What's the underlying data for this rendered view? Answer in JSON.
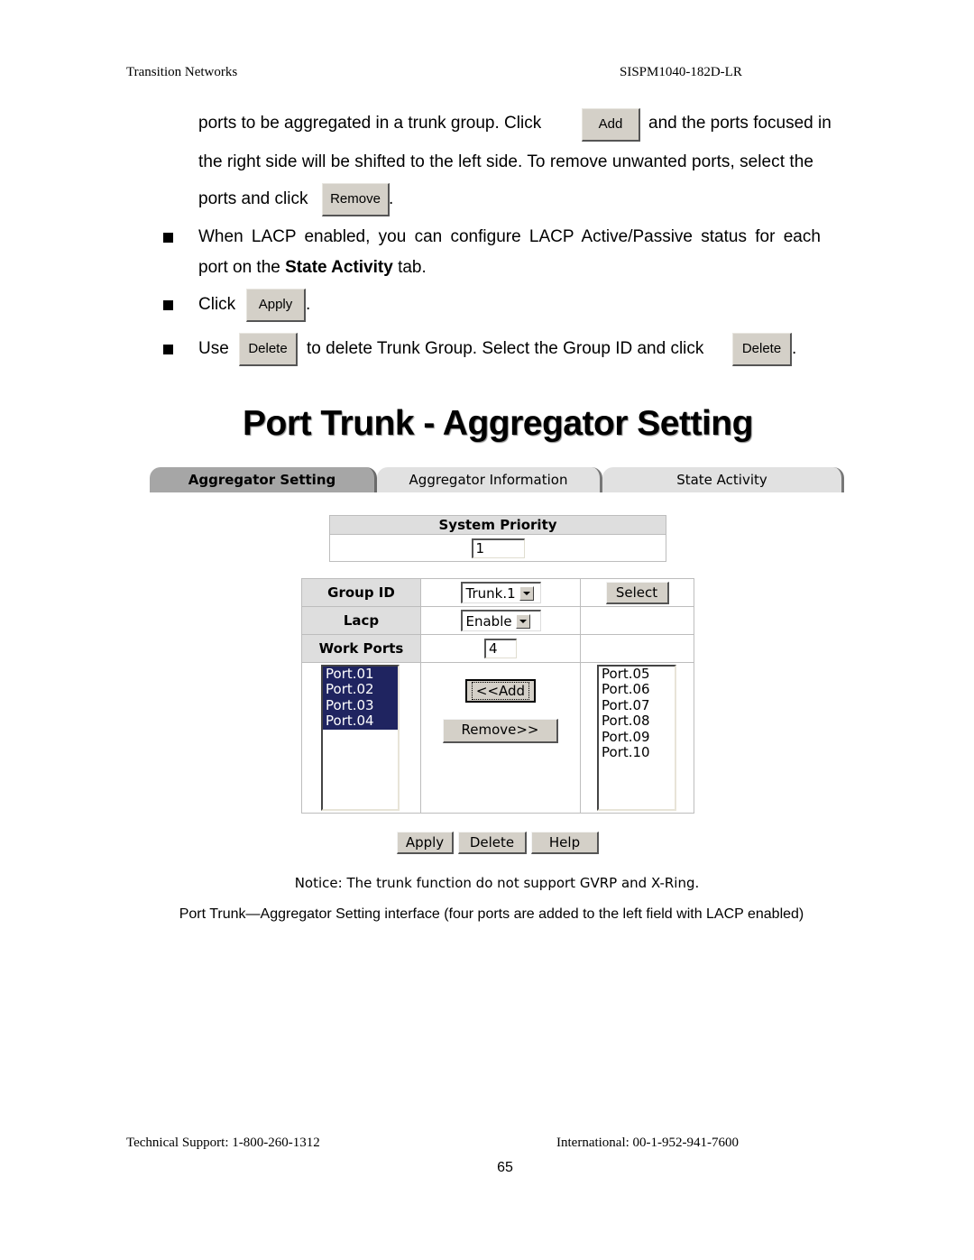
{
  "header": {
    "left": "Transition Networks",
    "right": "SISPM1040-182D-LR"
  },
  "body": {
    "line1_pre": "ports to be aggregated in a trunk group. Click",
    "line1_btn": "Add",
    "line1_post": "and the ports focused in",
    "line2": "the right side will be shifted to the left side. To remove unwanted ports, select the",
    "line3_pre": "ports and click",
    "line3_btn": "Remove",
    "line3_post": ".",
    "bullets": [
      {
        "line_a": "When LACP enabled, you can configure LACP Active/Passive status for each",
        "line_b_pre": "port on the ",
        "line_b_bold": "State Activity",
        "line_b_post": " tab."
      },
      {
        "pre": "Click",
        "btn": "Apply",
        "post": "."
      },
      {
        "pre": "Use",
        "btn": "Delete",
        "mid": "to delete Trunk Group. Select the Group ID and click",
        "btn2": "Delete",
        "post": "."
      }
    ]
  },
  "screenshot": {
    "title": "Port Trunk - Aggregator Setting",
    "tabs": [
      {
        "label": "Aggregator Setting",
        "active": true
      },
      {
        "label": "Aggregator Information",
        "active": false
      },
      {
        "label": "State Activity",
        "active": false
      }
    ],
    "system_priority": {
      "label": "System Priority",
      "value": "1"
    },
    "group_id": {
      "label": "Group ID",
      "value": "Trunk.1",
      "select_button": "Select"
    },
    "lacp": {
      "label": "Lacp",
      "value": "Enable"
    },
    "work_ports": {
      "label": "Work Ports",
      "value": "4"
    },
    "left_ports": [
      "Port.01",
      "Port.02",
      "Port.03",
      "Port.04"
    ],
    "right_ports": [
      "Port.05",
      "Port.06",
      "Port.07",
      "Port.08",
      "Port.09",
      "Port.10"
    ],
    "add_button": "<<Add",
    "remove_button": "Remove>>",
    "buttons": {
      "apply": "Apply",
      "delete": "Delete",
      "help": "Help"
    },
    "notice": "Notice: The trunk function do not support GVRP and X-Ring.",
    "colors": {
      "selected_bg": "#1f2460",
      "button_face": "#d4d0c8",
      "active_tab": "#a6a6a6",
      "inactive_tab": "#e1e1e1",
      "label_cell": "#dedede"
    }
  },
  "caption": "Port Trunk—Aggregator Setting interface (four ports are added to the left field with LACP enabled)",
  "footer": {
    "left": "Technical Support: 1-800-260-1312",
    "right": "International: 00-1-952-941-7600",
    "page": "65"
  }
}
